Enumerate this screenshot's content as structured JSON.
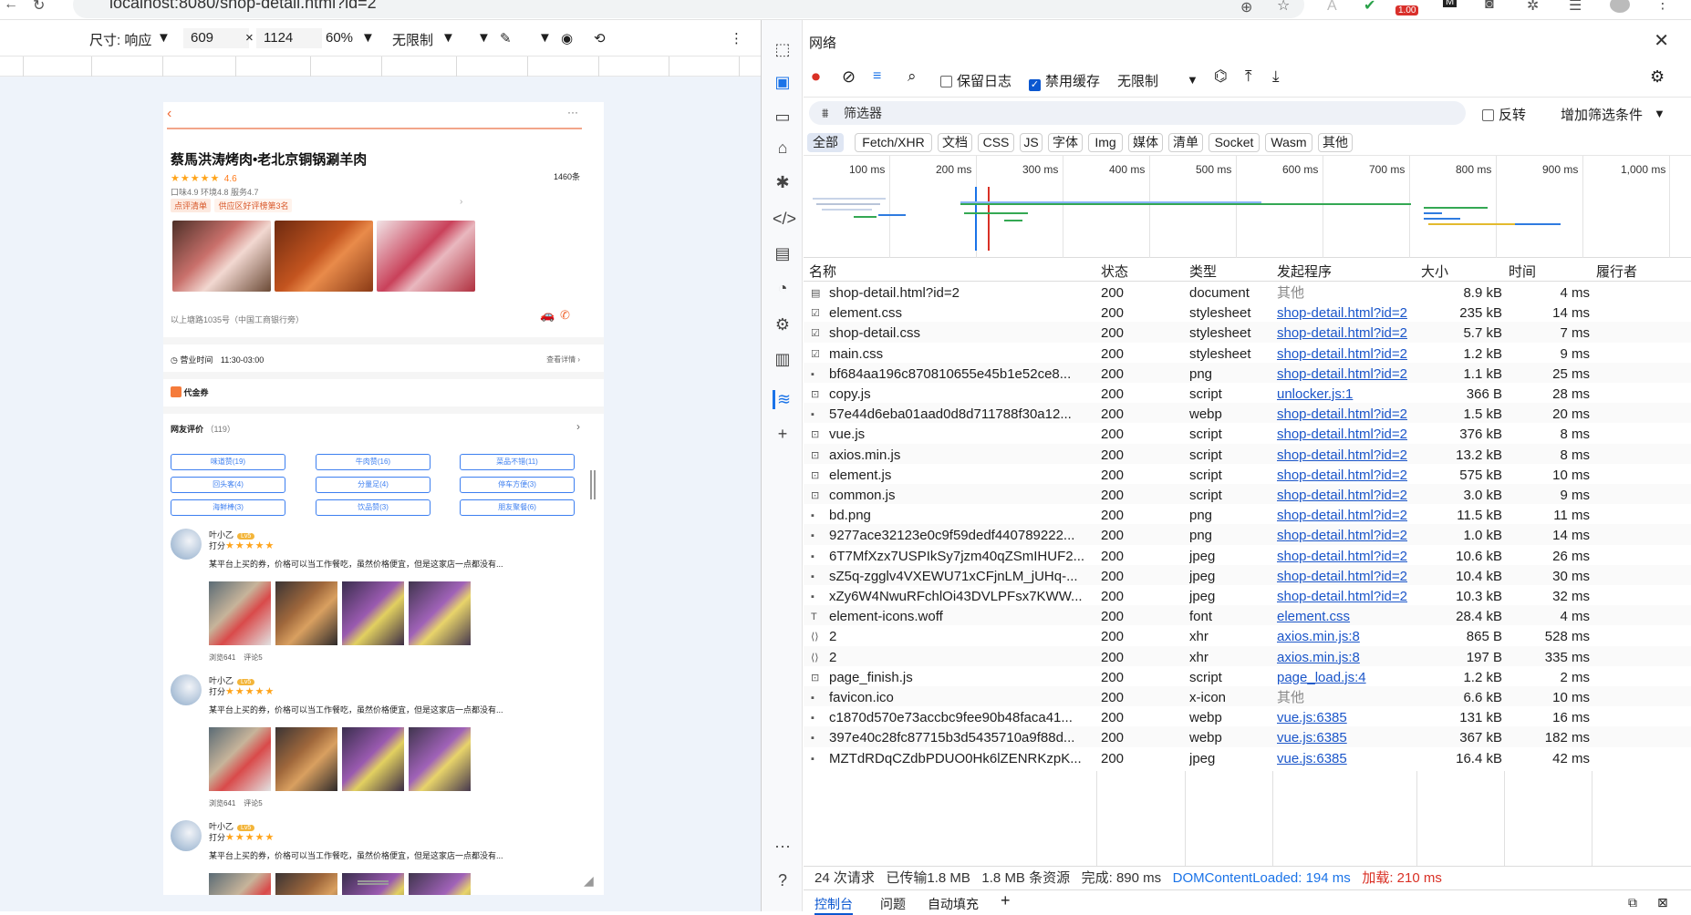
{
  "browser": {
    "url": "localhost:8080/shop-detail.html?id=2",
    "badge": "1.00"
  },
  "devtoolbar": {
    "size_label": "尺寸: 响应",
    "width": "609",
    "x": "×",
    "height": "1124",
    "zoom": "60%",
    "throttle": "无限制"
  },
  "shop": {
    "name": "蔡馬洪涛烤肉•老北京铜锅涮羊肉",
    "stars": "★★★★★",
    "rating": "4.6",
    "reviews_count": "1460条",
    "subscores": "口味4.9 环境4.8 服务4.7",
    "rank_tag": "点评清单",
    "rank_text": "供应区好评榜第3名",
    "address": "以上塘路1035号（中国工商银行旁）",
    "hours_label": "营业时间",
    "hours": "11:30-03:00",
    "hours_more": "查看详情 ›",
    "voucher": "代金券",
    "reviews_title": "网友评价",
    "reviews_total": "（119）",
    "chips": [
      "味道赞(19)",
      "牛肉赞(16)",
      "菜品不错(11)",
      "回头客(4)",
      "分量足(4)",
      "停车方便(3)",
      "海鲜棒(3)",
      "饮品赞(3)",
      "朋友聚餐(6)"
    ],
    "review_items": [
      {
        "name": "叶小乙",
        "level": "Lv5",
        "score_label": "打分",
        "stars": "★★★★★",
        "text": "某平台上买的券，价格可以当工作餐吃，虽然价格便宜，但是这家店一点都没有...",
        "views": "浏览641",
        "comments": "评论5"
      },
      {
        "name": "叶小乙",
        "level": "Lv5",
        "score_label": "打分",
        "stars": "★★★★★",
        "text": "某平台上买的券，价格可以当工作餐吃，虽然价格便宜，但是这家店一点都没有...",
        "views": "浏览641",
        "comments": "评论5"
      },
      {
        "name": "叶小乙",
        "level": "Lv5",
        "score_label": "打分",
        "stars": "★★★★★",
        "text": "某平台上买的券，价格可以当工作餐吃，虽然价格便宜，但是这家店一点都没有...",
        "views": "",
        "comments": ""
      }
    ]
  },
  "network": {
    "title": "网络",
    "preserve_log": "保留日志",
    "disable_cache": "禁用缓存",
    "throttle": "无限制",
    "filter_placeholder": "筛选器",
    "invert": "反转",
    "more_filters": "增加筛选条件",
    "types": [
      "全部",
      "Fetch/XHR",
      "文档",
      "CSS",
      "JS",
      "字体",
      "Img",
      "媒体",
      "清单",
      "Socket",
      "Wasm",
      "其他"
    ],
    "timeline_labels": [
      "100 ms",
      "200 ms",
      "300 ms",
      "400 ms",
      "500 ms",
      "600 ms",
      "700 ms",
      "800 ms",
      "900 ms",
      "1,000 ms"
    ],
    "columns": [
      "名称",
      "状态",
      "类型",
      "发起程序",
      "大小",
      "时间",
      "履行者"
    ],
    "rows": [
      {
        "name": "shop-detail.html?id=2",
        "status": "200",
        "type": "document",
        "initiator": "其他",
        "size": "8.9 kB",
        "time": "4 ms",
        "icon": "doc"
      },
      {
        "name": "element.css",
        "status": "200",
        "type": "stylesheet",
        "initiator": "shop-detail.html?id=2",
        "size": "235 kB",
        "time": "14 ms",
        "icon": "css"
      },
      {
        "name": "shop-detail.css",
        "status": "200",
        "type": "stylesheet",
        "initiator": "shop-detail.html?id=2",
        "size": "5.7 kB",
        "time": "7 ms",
        "icon": "css"
      },
      {
        "name": "main.css",
        "status": "200",
        "type": "stylesheet",
        "initiator": "shop-detail.html?id=2",
        "size": "1.2 kB",
        "time": "9 ms",
        "icon": "css"
      },
      {
        "name": "bf684aa196c870810655e45b1e52ce8...",
        "status": "200",
        "type": "png",
        "initiator": "shop-detail.html?id=2",
        "size": "1.1 kB",
        "time": "25 ms",
        "icon": "img"
      },
      {
        "name": "copy.js",
        "status": "200",
        "type": "script",
        "initiator": "unlocker.js:1",
        "size": "366 B",
        "time": "28 ms",
        "icon": "js"
      },
      {
        "name": "57e44d6eba01aad0d8d711788f30a12...",
        "status": "200",
        "type": "webp",
        "initiator": "shop-detail.html?id=2",
        "size": "1.5 kB",
        "time": "20 ms",
        "icon": "img"
      },
      {
        "name": "vue.js",
        "status": "200",
        "type": "script",
        "initiator": "shop-detail.html?id=2",
        "size": "376 kB",
        "time": "8 ms",
        "icon": "js"
      },
      {
        "name": "axios.min.js",
        "status": "200",
        "type": "script",
        "initiator": "shop-detail.html?id=2",
        "size": "13.2 kB",
        "time": "8 ms",
        "icon": "js"
      },
      {
        "name": "element.js",
        "status": "200",
        "type": "script",
        "initiator": "shop-detail.html?id=2",
        "size": "575 kB",
        "time": "10 ms",
        "icon": "js"
      },
      {
        "name": "common.js",
        "status": "200",
        "type": "script",
        "initiator": "shop-detail.html?id=2",
        "size": "3.0 kB",
        "time": "9 ms",
        "icon": "js"
      },
      {
        "name": "bd.png",
        "status": "200",
        "type": "png",
        "initiator": "shop-detail.html?id=2",
        "size": "11.5 kB",
        "time": "11 ms",
        "icon": "img"
      },
      {
        "name": "9277ace32123e0c9f59dedf440789222...",
        "status": "200",
        "type": "png",
        "initiator": "shop-detail.html?id=2",
        "size": "1.0 kB",
        "time": "14 ms",
        "icon": "img"
      },
      {
        "name": "6T7MfXzx7USPIkSy7jzm40qZSmIHUF2...",
        "status": "200",
        "type": "jpeg",
        "initiator": "shop-detail.html?id=2",
        "size": "10.6 kB",
        "time": "26 ms",
        "icon": "img"
      },
      {
        "name": "sZ5q-zgglv4VXEWU71xCFjnLM_jUHq-...",
        "status": "200",
        "type": "jpeg",
        "initiator": "shop-detail.html?id=2",
        "size": "10.4 kB",
        "time": "30 ms",
        "icon": "img"
      },
      {
        "name": "xZy6W4NwuRFchlOi43DVLPFsx7KWW...",
        "status": "200",
        "type": "jpeg",
        "initiator": "shop-detail.html?id=2",
        "size": "10.3 kB",
        "time": "32 ms",
        "icon": "img"
      },
      {
        "name": "element-icons.woff",
        "status": "200",
        "type": "font",
        "initiator": "element.css",
        "size": "28.4 kB",
        "time": "4 ms",
        "icon": "font"
      },
      {
        "name": "2",
        "status": "200",
        "type": "xhr",
        "initiator": "axios.min.js:8",
        "size": "865 B",
        "time": "528 ms",
        "icon": "xhr"
      },
      {
        "name": "2",
        "status": "200",
        "type": "xhr",
        "initiator": "axios.min.js:8",
        "size": "197 B",
        "time": "335 ms",
        "icon": "xhr"
      },
      {
        "name": "page_finish.js",
        "status": "200",
        "type": "script",
        "initiator": "page_load.js:4",
        "size": "1.2 kB",
        "time": "2 ms",
        "icon": "js"
      },
      {
        "name": "favicon.ico",
        "status": "200",
        "type": "x-icon",
        "initiator": "其他",
        "size": "6.6 kB",
        "time": "10 ms",
        "icon": "img"
      },
      {
        "name": "c1870d570e73accbc9fee90b48faca41...",
        "status": "200",
        "type": "webp",
        "initiator": "vue.js:6385",
        "size": "131 kB",
        "time": "16 ms",
        "icon": "img"
      },
      {
        "name": "397e40c28fc87715b3d5435710a9f88d...",
        "status": "200",
        "type": "webp",
        "initiator": "vue.js:6385",
        "size": "367 kB",
        "time": "182 ms",
        "icon": "img"
      },
      {
        "name": "MZTdRDqCZdbPDUO0Hk6lZENRKzpK...",
        "status": "200",
        "type": "jpeg",
        "initiator": "vue.js:6385",
        "size": "16.4 kB",
        "time": "42 ms",
        "icon": "img"
      }
    ],
    "summary": {
      "requests": "24 次请求",
      "transferred": "已传输1.8 MB",
      "resources": "1.8 MB 条资源",
      "finish": "完成: 890 ms",
      "dcl": "DOMContentLoaded: 194 ms",
      "load": "加载: 210 ms"
    },
    "drawer_tabs": [
      "控制台",
      "问题",
      "自动填充"
    ]
  },
  "colors": {
    "accent": "#0b57d0",
    "link": "#1a55c9",
    "load_red": "#d93025",
    "dcl_blue": "#1a73e8",
    "star": "#ffa41a",
    "chip_blue": "#3d7ff0"
  }
}
